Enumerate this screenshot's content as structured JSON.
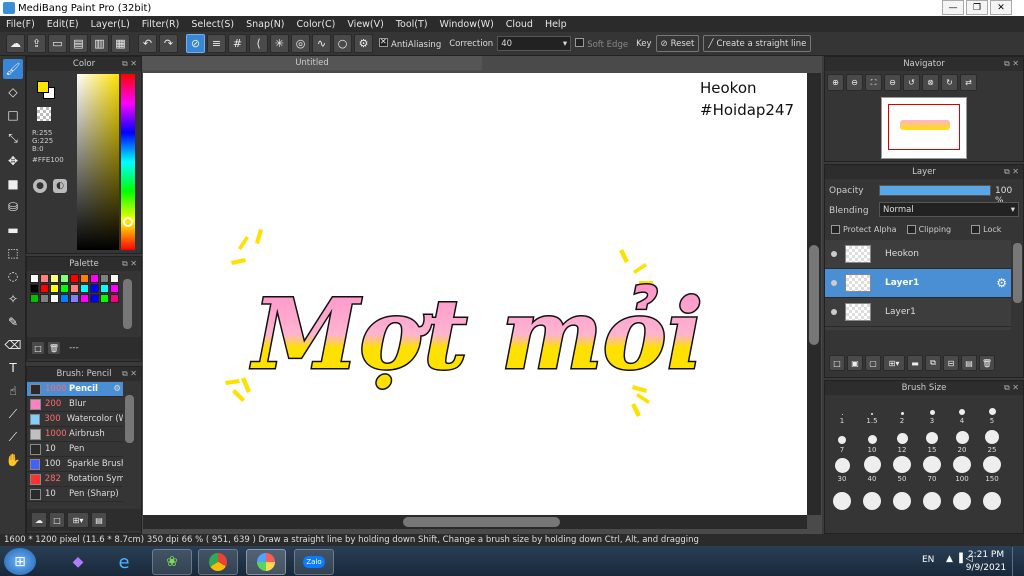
{
  "window": {
    "title": "MediBang Paint Pro (32bit)",
    "controls": [
      "—",
      "❐",
      "✕"
    ]
  },
  "menu": [
    "File(F)",
    "Edit(E)",
    "Layer(L)",
    "Filter(R)",
    "Select(S)",
    "Snap(N)",
    "Color(C)",
    "View(V)",
    "Tool(T)",
    "Window(W)",
    "Cloud",
    "Help"
  ],
  "toolbar": {
    "antialiasing_label": "AntiAliasing",
    "correction_label": "Correction",
    "correction_value": "40",
    "soft_edge_label": "Soft Edge",
    "key_label": "Key",
    "reset_label": "Reset",
    "straight_line_label": "Create a straight line"
  },
  "color_panel": {
    "title": "Color",
    "r": "R:255",
    "g": "G:225",
    "b": "B:0",
    "hex": "#FFE100",
    "primary_color": "#FFE100",
    "secondary_color": "#FFFFFF"
  },
  "palette_panel": {
    "title": "Palette",
    "footer_text": "---",
    "colors": [
      "#ffffff",
      "#ff8080",
      "#ffff80",
      "#80ff80",
      "#ff0000",
      "#ff8000",
      "#ff00ff",
      "#808080",
      "#ffffff",
      "#000000",
      "#ff0000",
      "#ffff00",
      "#00ff00",
      "#ff8080",
      "#00ffff",
      "#0000ff",
      "#00ffff",
      "#ff00ff",
      "#00c000",
      "#808080",
      "#ffffff",
      "#0080ff",
      "#8080ff",
      "#ff00ff",
      "#0000ff",
      "#00ff00",
      "#ff0080"
    ]
  },
  "brush_panel": {
    "title": "Brush: Pencil",
    "items": [
      {
        "size": "1000",
        "name": "Pencil",
        "color": "#2a2a2a",
        "selected": true
      },
      {
        "size": "200",
        "name": "Blur",
        "color": "#ff80c0"
      },
      {
        "size": "300",
        "name": "Watercolor (W",
        "color": "#80d0ff"
      },
      {
        "size": "1000",
        "name": "Airbrush",
        "color": "#c0c0c0"
      },
      {
        "size": "10",
        "name": "Pen",
        "color": "#2a2a2a"
      },
      {
        "size": "100",
        "name": "Sparkle Brush",
        "color": "#4060ff"
      },
      {
        "size": "282",
        "name": "Rotation Sym",
        "color": "#ff3030"
      },
      {
        "size": "10",
        "name": "Pen (Sharp)",
        "color": "#2a2a2a"
      }
    ]
  },
  "document": {
    "tab_title": "Untitled"
  },
  "canvas_text": {
    "watermark_line1": "Heokon",
    "watermark_line2": "#Hoidap247",
    "artwork_text": "Mợt mỏi"
  },
  "navigator": {
    "title": "Navigator"
  },
  "layer_panel": {
    "title": "Layer",
    "opacity_label": "Opacity",
    "opacity_value": "100 %",
    "opacity_fraction": 1.0,
    "blending_label": "Blending",
    "blending_value": "Normal",
    "protect_alpha_label": "Protect Alpha",
    "clipping_label": "Clipping",
    "lock_label": "Lock",
    "layers": [
      {
        "name": "Heokon",
        "selected": false
      },
      {
        "name": "Layer1",
        "selected": true
      },
      {
        "name": "Layer1",
        "selected": false
      }
    ]
  },
  "brush_size_panel": {
    "title": "Brush Size",
    "sizes": [
      "1",
      "1.5",
      "2",
      "3",
      "4",
      "5",
      "7",
      "10",
      "12",
      "15",
      "20",
      "25",
      "30",
      "40",
      "50",
      "70",
      "100",
      "150",
      "",
      "",
      "",
      "",
      "",
      ""
    ]
  },
  "statusbar": {
    "text": "1600 * 1200 pixel   (11.6 * 8.7cm)   350 dpi   66 %   ( 951, 639 )   Draw a straight line by holding down Shift, Change a brush size by holding down Ctrl, Alt, and dragging"
  },
  "taskbar": {
    "language": "EN",
    "time": "2:21 PM",
    "date": "9/9/2021",
    "zalo_label": "Zalo"
  }
}
